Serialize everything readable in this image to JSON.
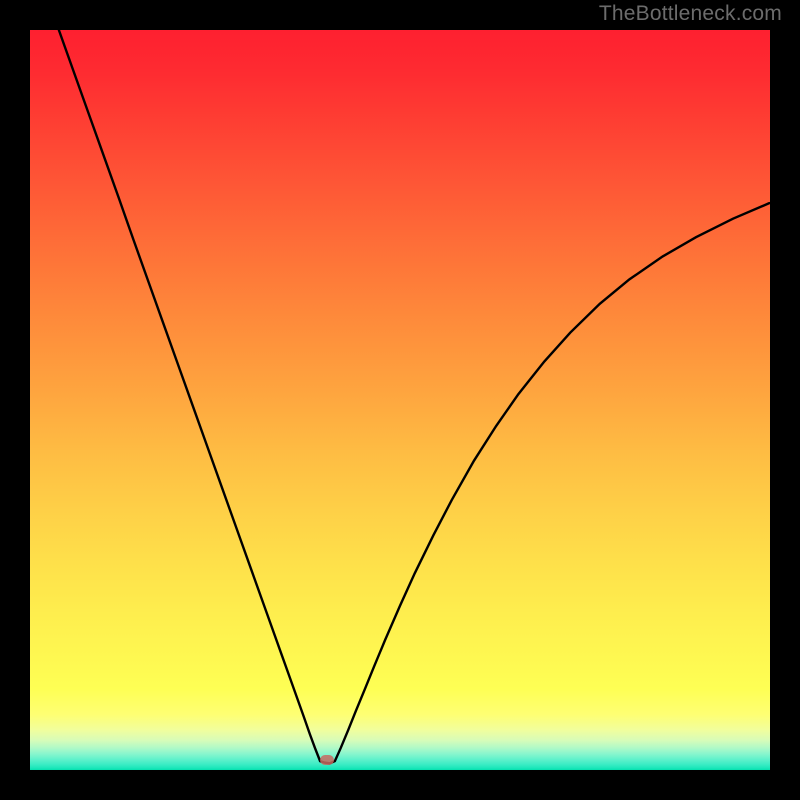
{
  "watermark": "TheBottleneck.com",
  "dot": {
    "x_pct": 40.1,
    "y_pct": 98.6,
    "color": "#c86a60"
  },
  "chart_data": {
    "type": "line",
    "title": "",
    "xlabel": "",
    "ylabel": "",
    "xlim": [
      0,
      100
    ],
    "ylim": [
      0,
      100
    ],
    "grid": false,
    "legend": false,
    "background": "red-yellow-green vertical gradient",
    "series": [
      {
        "name": "bottleneck-curve",
        "x": [
          3.9,
          6,
          8,
          10,
          12,
          14,
          16,
          18,
          20,
          22,
          24,
          26,
          28,
          30,
          32,
          34,
          35,
          36,
          37,
          37.8,
          38.5,
          39.2,
          39.8,
          40.5,
          41.2,
          42,
          43,
          44,
          45.2,
          46.5,
          48,
          50,
          52,
          54.5,
          57,
          60,
          63,
          66,
          69.5,
          73,
          77,
          81,
          85.5,
          90,
          95,
          99.9
        ],
        "y": [
          100,
          94.1,
          88.5,
          82.9,
          77.3,
          71.6,
          66,
          60.4,
          54.8,
          49.2,
          43.6,
          38,
          32.4,
          26.8,
          21.2,
          15.6,
          12.8,
          10,
          7.2,
          4.9,
          3,
          1.2,
          1,
          0.9,
          1.2,
          3,
          5.4,
          7.9,
          10.8,
          14,
          17.6,
          22.2,
          26.6,
          31.7,
          36.5,
          41.8,
          46.5,
          50.8,
          55.2,
          59.1,
          63,
          66.3,
          69.4,
          72,
          74.5,
          76.6
        ]
      }
    ],
    "marker": {
      "x": 40.1,
      "y": 1.4,
      "color": "#c86a60",
      "shape": "rounded-rect"
    }
  }
}
